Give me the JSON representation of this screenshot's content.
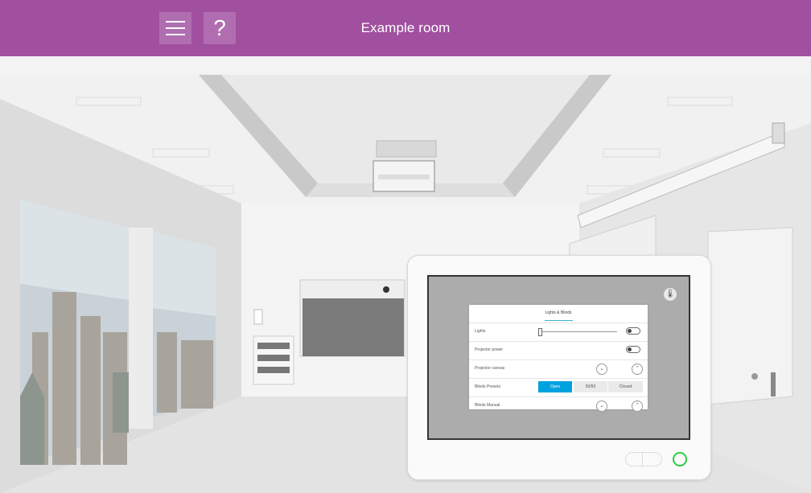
{
  "header": {
    "title": "Example room",
    "menu_icon": "hamburger-menu-icon",
    "help_label": "?"
  },
  "panel": {
    "thermostat_icon": "thermometer-icon",
    "tab_title": "Lights & Blinds",
    "rows": [
      {
        "label": "Lights",
        "control": "slider+toggle"
      },
      {
        "label": "Projector power",
        "control": "toggle"
      },
      {
        "label": "Projector canvas",
        "control": "up-down"
      },
      {
        "label": "Blinds Presets",
        "control": "segmented"
      },
      {
        "label": "Blinds Manual",
        "control": "up-down"
      }
    ],
    "lights_level": 0,
    "blinds_presets": [
      "Open",
      "50/50",
      "Closed"
    ],
    "blinds_selected": "Open",
    "down_symbol": "⌄",
    "up_symbol": "⌃"
  },
  "colors": {
    "header_bg": "#a150a0",
    "accent": "#00a1df",
    "status_ring": "#2ecc40"
  }
}
